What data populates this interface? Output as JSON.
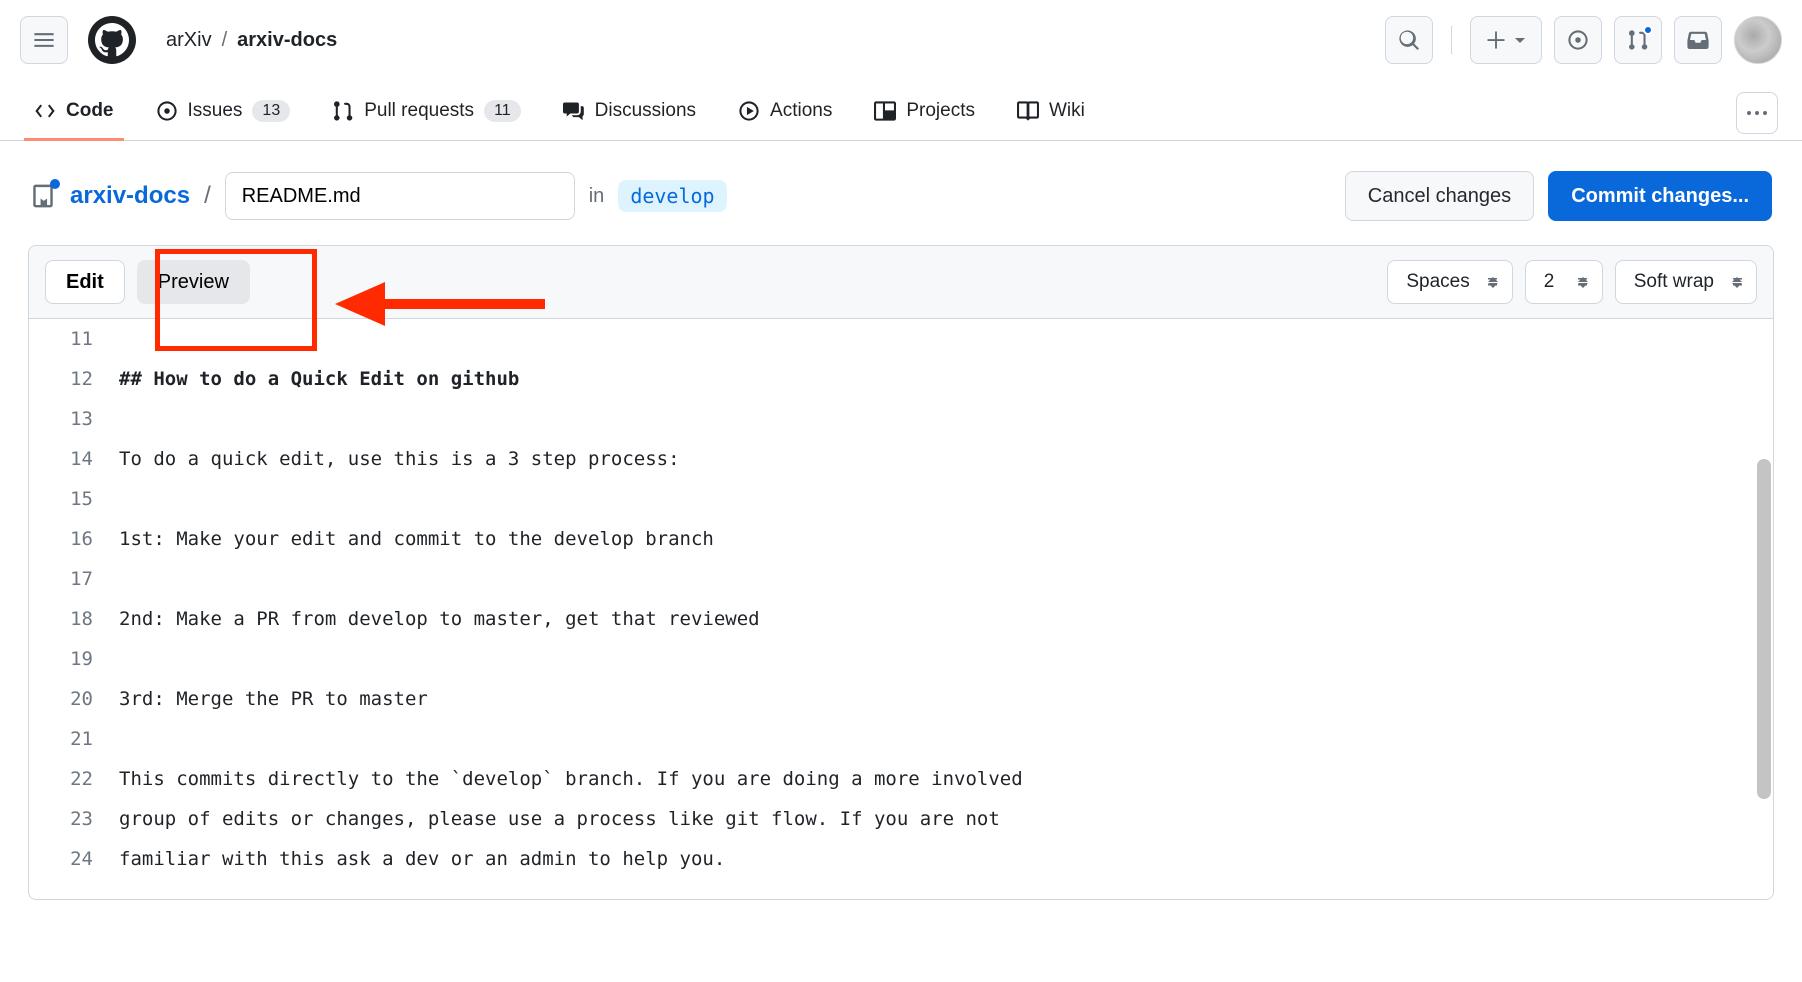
{
  "breadcrumb": {
    "owner": "arXiv",
    "repo": "arxiv-docs"
  },
  "nav": {
    "code": "Code",
    "issues": "Issues",
    "issues_count": "13",
    "pulls": "Pull requests",
    "pulls_count": "11",
    "discussions": "Discussions",
    "actions": "Actions",
    "projects": "Projects",
    "wiki": "Wiki"
  },
  "file": {
    "repo_link": "arxiv-docs",
    "filename": "README.md",
    "in": "in",
    "branch": "develop",
    "cancel": "Cancel changes",
    "commit": "Commit changes..."
  },
  "editor": {
    "edit_tab": "Edit",
    "preview_tab": "Preview",
    "indent": "Spaces",
    "indent_size": "2",
    "wrap": "Soft wrap"
  },
  "code_lines": [
    {
      "n": "11",
      "t": ""
    },
    {
      "n": "12",
      "t": "## How to do a Quick Edit on github",
      "bold": true
    },
    {
      "n": "13",
      "t": ""
    },
    {
      "n": "14",
      "t": "To do a quick edit, use this is a 3 step process:"
    },
    {
      "n": "15",
      "t": ""
    },
    {
      "n": "16",
      "t": "1st: Make your edit and commit to the develop branch"
    },
    {
      "n": "17",
      "t": ""
    },
    {
      "n": "18",
      "t": "2nd: Make a PR from develop to master, get that reviewed"
    },
    {
      "n": "19",
      "t": ""
    },
    {
      "n": "20",
      "t": "3rd: Merge the PR to master"
    },
    {
      "n": "21",
      "t": ""
    },
    {
      "n": "22",
      "t": "This commits directly to the `develop` branch. If you are doing a more involved"
    },
    {
      "n": "23",
      "t": "group of edits or changes, please use a process like git flow. If you are not"
    },
    {
      "n": "24",
      "t": "familiar with this ask a dev or an admin to help you."
    }
  ]
}
